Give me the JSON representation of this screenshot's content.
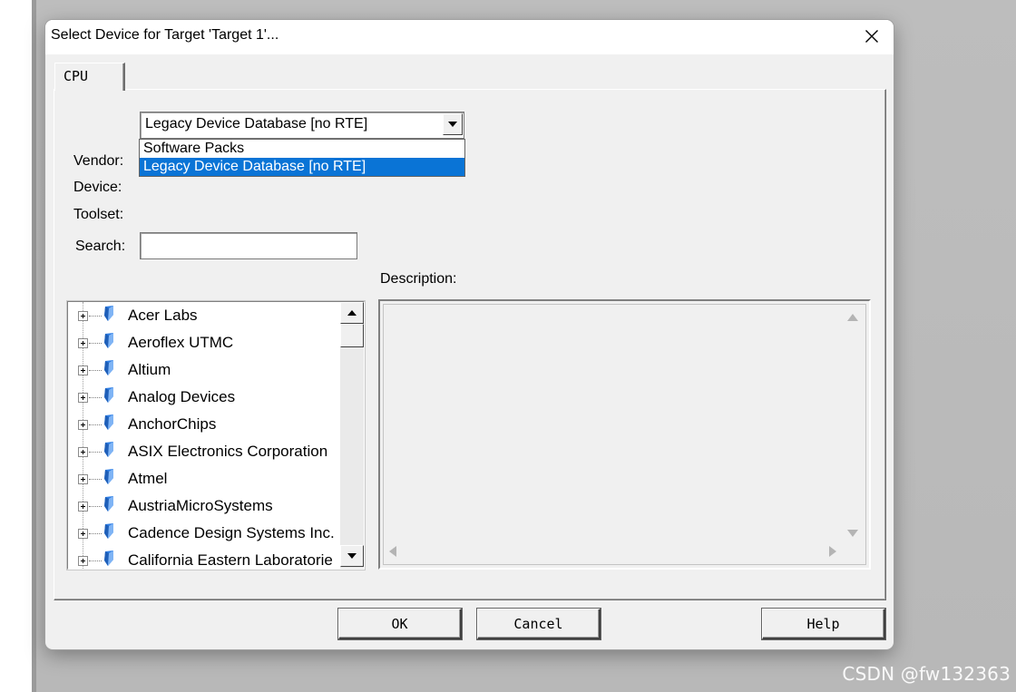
{
  "window": {
    "title": "Select Device for Target 'Target 1'..."
  },
  "tabs": [
    {
      "label": "CPU"
    }
  ],
  "combo": {
    "value": "Legacy Device Database [no RTE]",
    "options": [
      "Software Packs",
      "Legacy Device Database [no RTE]"
    ]
  },
  "labels": {
    "vendor": "Vendor:",
    "device": "Device:",
    "toolset": "Toolset:",
    "search": "Search:",
    "description": "Description:"
  },
  "search": {
    "value": "",
    "placeholder": ""
  },
  "vendors": [
    "Acer Labs",
    "Aeroflex UTMC",
    "Altium",
    "Analog Devices",
    "AnchorChips",
    "ASIX Electronics Corporation",
    "Atmel",
    "AustriaMicroSystems",
    "Cadence Design Systems Inc.",
    "California Eastern Laboratorie"
  ],
  "buttons": {
    "ok": "OK",
    "cancel": "Cancel",
    "help": "Help"
  },
  "watermark": "CSDN @fw132363",
  "colors": {
    "selection": "#0a74d6",
    "gem_icon": "#2f7fe6"
  }
}
